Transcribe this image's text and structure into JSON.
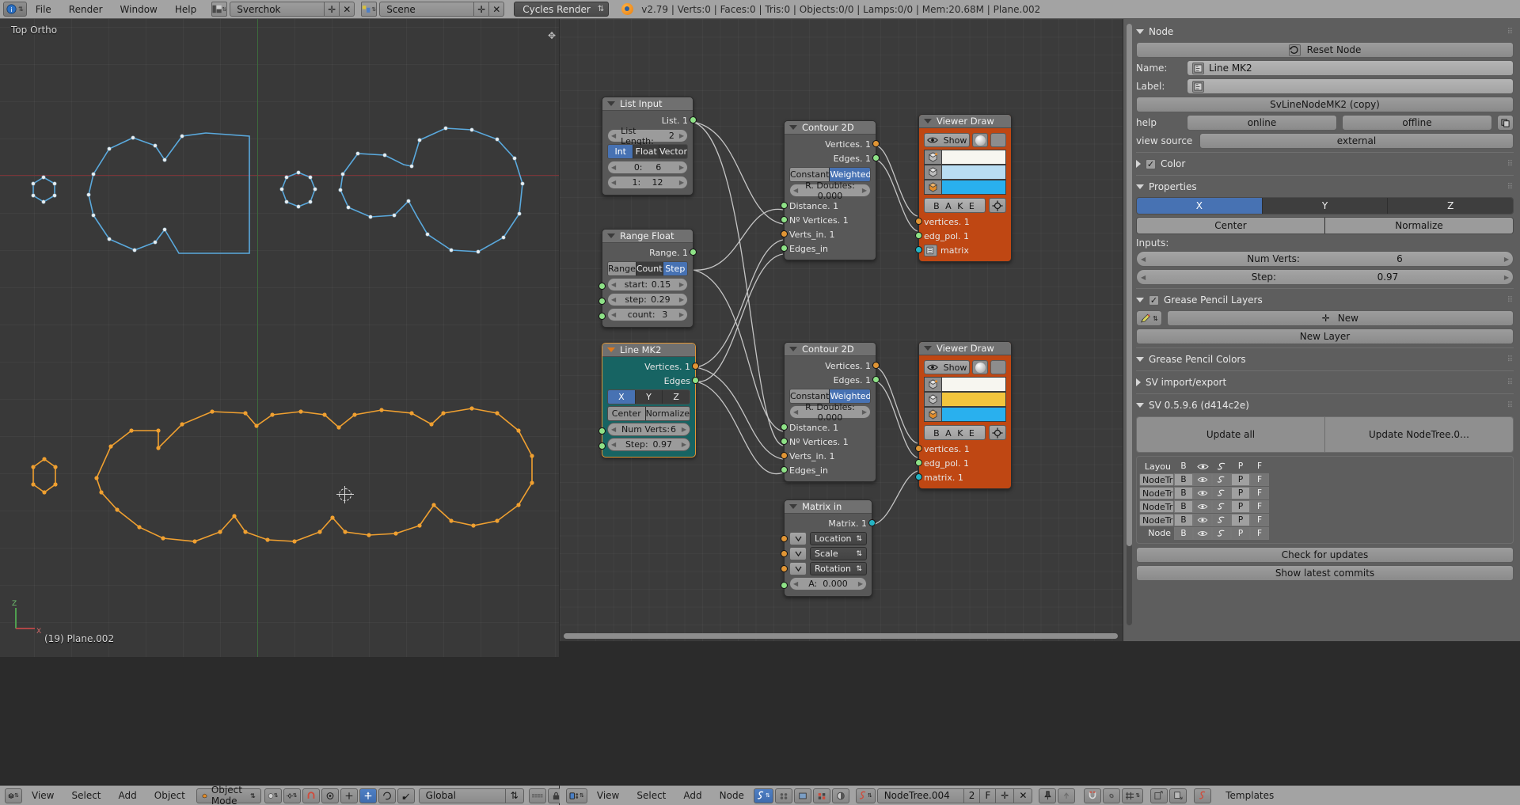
{
  "topbar": {
    "menus": [
      "File",
      "Render",
      "Window",
      "Help"
    ],
    "screen_layout": "Sverchok",
    "scene": "Scene",
    "engine": "Cycles Render",
    "stats": "v2.79 | Verts:0 | Faces:0 | Tris:0 | Objects:0/0 | Lamps:0/0 | Mem:20.68M | Plane.002",
    "add_icon": "plus-icon",
    "close_icon": "x-icon"
  },
  "viewport": {
    "view_label": "Top Ortho",
    "object_name": "(19) Plane.002",
    "axis_z_label": "Z",
    "axis_x_label": "X"
  },
  "nodes": [
    {
      "id": "list-input",
      "title": "List Input",
      "outputs": [
        {
          "label": "List. 1",
          "color": "green"
        }
      ],
      "fields": [
        {
          "label": "List Length:",
          "value": "2"
        }
      ],
      "segmented": [
        "Int",
        "Float",
        "Vector"
      ],
      "segmented_active": 0,
      "rows": [
        {
          "label": "0:",
          "value": "6"
        },
        {
          "label": "1:",
          "value": "12"
        }
      ]
    },
    {
      "id": "range-float",
      "title": "Range Float",
      "outputs": [
        {
          "label": "Range. 1",
          "color": "green"
        }
      ],
      "segmented": [
        "Range",
        "Count",
        "Step"
      ],
      "segmented_active": 2,
      "inputs": [
        {
          "label": "start:",
          "value": "0.15",
          "color": "green"
        },
        {
          "label": "step:",
          "value": "0.29",
          "color": "green"
        },
        {
          "label": "count:",
          "value": "3",
          "color": "green"
        }
      ]
    },
    {
      "id": "line-mk2",
      "title": "Line MK2",
      "selected": true,
      "outputs": [
        {
          "label": "Vertices. 1",
          "color": "orange"
        },
        {
          "label": "Edges",
          "color": "green"
        }
      ],
      "axis": [
        "X",
        "Y",
        "Z"
      ],
      "axis_active": 0,
      "mode": [
        "Center",
        "Normalize"
      ],
      "inputs": [
        {
          "label": "Num Verts:",
          "value": "6",
          "color": "green"
        },
        {
          "label": "Step:",
          "value": "0.97",
          "color": "green"
        }
      ]
    },
    {
      "id": "contour-2d-top",
      "title": "Contour 2D",
      "outputs": [
        {
          "label": "Vertices. 1",
          "color": "orange"
        },
        {
          "label": "Edges. 1",
          "color": "green"
        }
      ],
      "segmented": [
        "Constant",
        "Weighted"
      ],
      "segmented_active": 1,
      "field": {
        "label": "R. Doubles: 0.000"
      },
      "inputs": [
        {
          "label": "Distance. 1",
          "color": "green"
        },
        {
          "label": "Nº Vertices. 1",
          "color": "green"
        },
        {
          "label": "Verts_in. 1",
          "color": "orange"
        },
        {
          "label": "Edges_in",
          "color": "green"
        }
      ]
    },
    {
      "id": "contour-2d-bottom",
      "title": "Contour 2D",
      "outputs": [
        {
          "label": "Vertices. 1",
          "color": "orange"
        },
        {
          "label": "Edges. 1",
          "color": "green"
        }
      ],
      "segmented": [
        "Constant",
        "Weighted"
      ],
      "segmented_active": 1,
      "field": {
        "label": "R. Doubles: 0.000"
      },
      "inputs": [
        {
          "label": "Distance. 1",
          "color": "green"
        },
        {
          "label": "Nº Vertices. 1",
          "color": "green"
        },
        {
          "label": "Verts_in. 1",
          "color": "orange"
        },
        {
          "label": "Edges_in",
          "color": "green"
        }
      ]
    },
    {
      "id": "viewer-draw-top",
      "title": "Viewer Draw",
      "show_label": "Show",
      "colors": [
        "#f7f6f0",
        "#b9ddf2",
        "#29b0ee"
      ],
      "bake_label": "B A K E",
      "inputs": [
        {
          "label": "vertices. 1",
          "color": "orange"
        },
        {
          "label": "edg_pol. 1",
          "color": "green"
        },
        {
          "label": "matrix",
          "color": "cyan"
        }
      ]
    },
    {
      "id": "viewer-draw-bottom",
      "title": "Viewer Draw",
      "show_label": "Show",
      "colors": [
        "#f7f6f0",
        "#f2c53d",
        "#29b0ee"
      ],
      "bake_label": "B A K E",
      "inputs": [
        {
          "label": "vertices. 1",
          "color": "orange"
        },
        {
          "label": "edg_pol. 1",
          "color": "green"
        },
        {
          "label": "matrix. 1",
          "color": "cyan"
        }
      ]
    },
    {
      "id": "matrix-in",
      "title": "Matrix in",
      "outputs": [
        {
          "label": "Matrix. 1",
          "color": "cyan"
        }
      ],
      "dropdowns": [
        "Location",
        "Scale",
        "Rotation"
      ],
      "inputs": [
        {
          "label": "A:",
          "value": "0.000",
          "color": "green"
        }
      ]
    }
  ],
  "properties": {
    "node_section": {
      "title": "Node",
      "reset_label": "Reset Node",
      "name_label": "Name:",
      "name_value": "Line MK2",
      "label_label": "Label:",
      "label_value": "",
      "class_label": "SvLineNodeMK2 (copy)",
      "help_label": "help",
      "help_online": "online",
      "help_offline": "offline",
      "view_source_label": "view source",
      "view_source_value": "external",
      "color_label": "Color"
    },
    "properties_section": {
      "title": "Properties",
      "axis": [
        "X",
        "Y",
        "Z"
      ],
      "axis_active": 0,
      "mode": [
        "Center",
        "Normalize"
      ],
      "inputs_label": "Inputs:",
      "fields": [
        {
          "label": "Num Verts:",
          "value": "6"
        },
        {
          "label": "Step:",
          "value": "0.97"
        }
      ]
    },
    "grease_pencil_layers": {
      "title": "Grease Pencil Layers",
      "new_label": "New",
      "new_layer_label": "New Layer"
    },
    "grease_pencil_colors": {
      "title": "Grease Pencil Colors"
    },
    "sv_import_export": {
      "title": "SV import/export"
    },
    "sv_version": {
      "title": "SV 0.5.9.6 (d414c2e)",
      "update_all": "Update all",
      "update_nodetree": "Update NodeTree.0…",
      "table_header": [
        "Layou",
        "B",
        "eye-icon",
        "process-icon",
        "P",
        "F"
      ],
      "table_rows": [
        [
          "NodeTr",
          "B",
          "eye-icon",
          "process-icon",
          "P",
          "F"
        ],
        [
          "NodeTr",
          "B",
          "eye-icon",
          "process-icon",
          "P",
          "F"
        ],
        [
          "NodeTr",
          "B",
          "eye-icon",
          "process-icon",
          "P",
          "F"
        ],
        [
          "NodeTr",
          "B",
          "eye-icon",
          "process-icon",
          "P",
          "F"
        ],
        [
          "Node",
          "B",
          "eye-icon",
          "process-icon",
          "P",
          "F"
        ]
      ],
      "check_updates": "Check for updates",
      "show_commits": "Show latest commits"
    }
  },
  "bottombar_3d": {
    "menus": [
      "View",
      "Select",
      "Add",
      "Object"
    ],
    "mode": "Object Mode",
    "transform_orientation": "Global"
  },
  "bottombar_node": {
    "menus": [
      "View",
      "Select",
      "Add",
      "Node"
    ],
    "tree_name": "NodeTree.004",
    "users_count": "2",
    "fake_user": "F",
    "templates": "Templates"
  }
}
